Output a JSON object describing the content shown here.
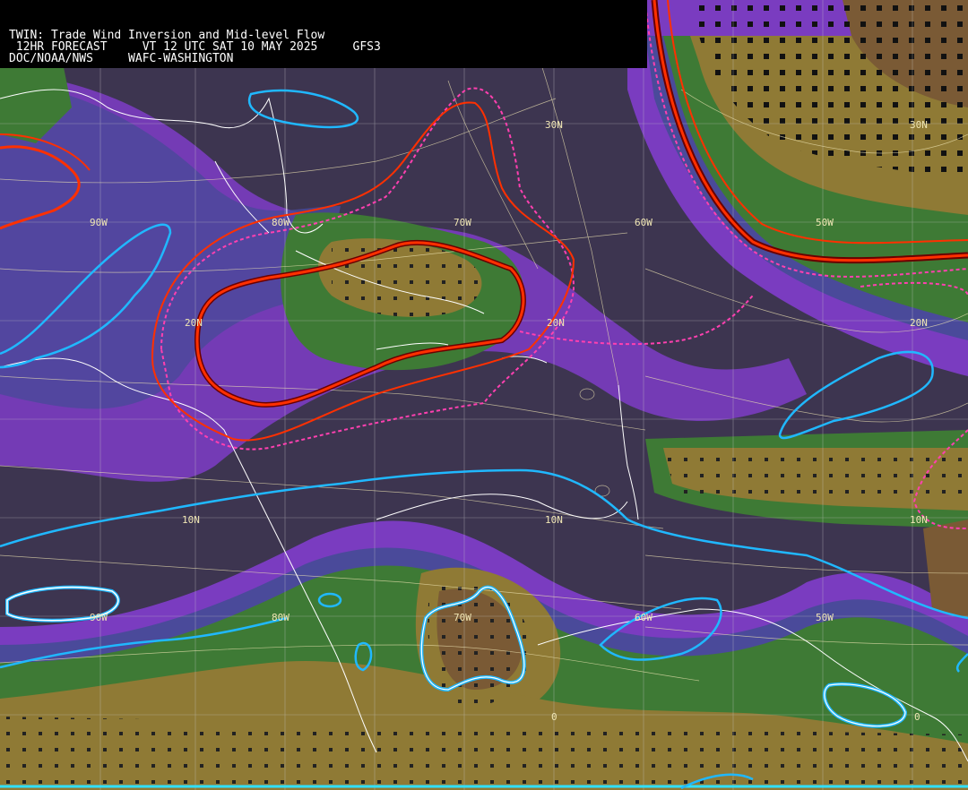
{
  "header": {
    "line1": "TWIN: Trade Wind Inversion and Mid-level Flow",
    "line2": " 12HR FORECAST     VT 12 UTC SAT 10 MAY 2025     GFS3",
    "line3": "DOC/NOAA/NWS     WAFC-WASHINGTON"
  },
  "lat_labels": [
    "30N",
    "20N",
    "10N",
    "0"
  ],
  "lon_labels": [
    "90W",
    "80W",
    "70W",
    "60W",
    "50W"
  ],
  "colors": {
    "background": "#3d3550",
    "purple": "#7a3cc0",
    "blue": "#4a4a9a",
    "green": "#3e7a35",
    "lightgreen": "#5a8f3a",
    "olive": "#8f7a35",
    "brown": "#7a5a35",
    "red_contour": "#ff3000",
    "pink_dashed": "#ff40b0",
    "cyan_contour": "#20b8ff",
    "streamlines": "#f0e6b4",
    "coastline": "#ffffff"
  },
  "legend": {}
}
